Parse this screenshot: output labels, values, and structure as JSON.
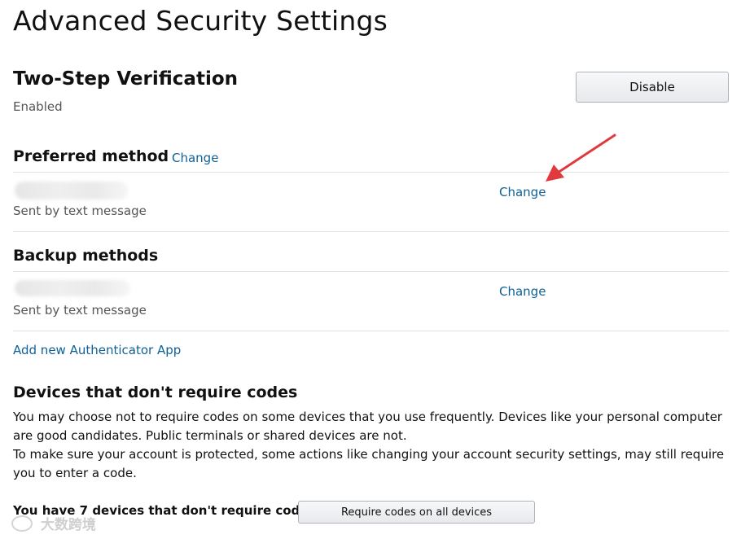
{
  "page": {
    "title": "Advanced Security Settings"
  },
  "two_step": {
    "heading": "Two-Step Verification",
    "status": "Enabled",
    "disable_label": "Disable"
  },
  "preferred": {
    "heading": "Preferred method",
    "heading_change_label": "Change",
    "method_sub": "Sent by text message",
    "change_label": "Change"
  },
  "backup": {
    "heading": "Backup methods",
    "method_sub": "Sent by text message",
    "change_label": "Change"
  },
  "add_app_label": "Add new Authenticator App",
  "devices": {
    "heading": "Devices that don't require codes",
    "paragraph1": "You may choose not to require codes on some devices that you use frequently. Devices like your personal computer are good candidates. Public terminals or shared devices are not.",
    "paragraph2": "To make sure your account is protected, some actions like changing your account security settings, may still require you to enter a code.",
    "count_text": "You have 7 devices that don't require codes",
    "require_button_label": "Require codes on all devices"
  },
  "watermark": {
    "text": "大数跨境"
  },
  "colors": {
    "link": "#0f6196",
    "annotation_arrow": "#e0393e"
  },
  "icons": {
    "annotation": "red-arrow-icon",
    "watermark": "watermark-logo-icon"
  }
}
